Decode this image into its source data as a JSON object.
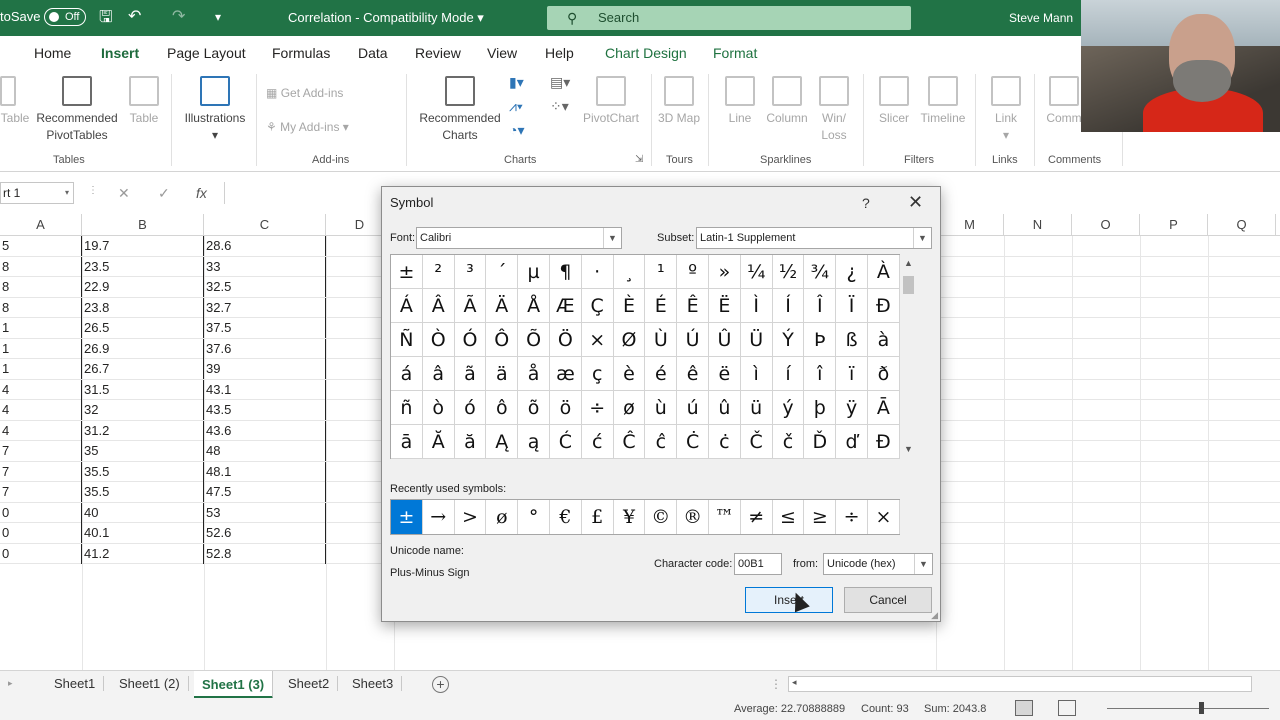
{
  "titlebar": {
    "autosave_label": "toSave",
    "autosave_state": "Off",
    "doc_title": "Correlation  -  Compatibility Mode",
    "search_placeholder": "Search",
    "user": "Steve Mann"
  },
  "ribbon_tabs": [
    "Home",
    "Insert",
    "Page Layout",
    "Formulas",
    "Data",
    "Review",
    "View",
    "Help",
    "Chart Design",
    "Format"
  ],
  "ribbon": {
    "tables": {
      "label": "Tables",
      "btn1": "Table",
      "btn2": "Recommended PivotTables",
      "btn3": "Table"
    },
    "illustrations": {
      "label": "Illustrations"
    },
    "addins": {
      "label": "Add-ins",
      "get": "Get Add-ins",
      "my": "My Add-ins"
    },
    "charts": {
      "label": "Charts",
      "recommended": "Recommended Charts",
      "pivotchart": "PivotChart"
    },
    "tours": {
      "label": "Tours",
      "map3d": "3D Map"
    },
    "sparklines": {
      "label": "Sparklines",
      "line": "Line",
      "column": "Column",
      "winloss": "Win/ Loss"
    },
    "filters": {
      "label": "Filters",
      "slicer": "Slicer",
      "timeline": "Timeline"
    },
    "links": {
      "label": "Links",
      "link": "Link"
    },
    "comments": {
      "label": "Comments",
      "comment": "Comm"
    }
  },
  "formula_bar": {
    "name_box": "rt 1",
    "cancel": "✕",
    "enter": "✓",
    "fx": "fx"
  },
  "columns": [
    "A",
    "B",
    "C",
    "D",
    "M",
    "N",
    "O",
    "P",
    "Q"
  ],
  "rows": [
    [
      "5",
      "19.7",
      "28.6"
    ],
    [
      "8",
      "23.5",
      "33"
    ],
    [
      "8",
      "22.9",
      "32.5"
    ],
    [
      "8",
      "23.8",
      "32.7"
    ],
    [
      "1",
      "26.5",
      "37.5"
    ],
    [
      "1",
      "26.9",
      "37.6"
    ],
    [
      "1",
      "26.7",
      "39"
    ],
    [
      "4",
      "31.5",
      "43.1"
    ],
    [
      "4",
      "32",
      "43.5"
    ],
    [
      "4",
      "31.2",
      "43.6"
    ],
    [
      "7",
      "35",
      "48"
    ],
    [
      "7",
      "35.5",
      "48.1"
    ],
    [
      "7",
      "35.5",
      "47.5"
    ],
    [
      "0",
      "40",
      "53"
    ],
    [
      "0",
      "40.1",
      "52.6"
    ],
    [
      "0",
      "41.2",
      "52.8"
    ]
  ],
  "sheet_tabs": [
    "Sheet1",
    "Sheet1 (2)",
    "Sheet1 (3)",
    "Sheet2",
    "Sheet3"
  ],
  "active_sheet": "Sheet1 (3)",
  "statusbar": {
    "average": "Average: 22.70888889",
    "count": "Count: 93",
    "sum": "Sum: 2043.8"
  },
  "dialog": {
    "title": "Symbol",
    "help": "?",
    "close": "✕",
    "font_label": "Font:",
    "font_value": "Calibri",
    "subset_label": "Subset:",
    "subset_value": "Latin-1 Supplement",
    "symbols": [
      "±",
      "²",
      "³",
      "´",
      "µ",
      "¶",
      "·",
      "¸",
      "¹",
      "º",
      "»",
      "¼",
      "½",
      "¾",
      "¿",
      "À",
      "Á",
      "Â",
      "Ã",
      "Ä",
      "Å",
      "Æ",
      "Ç",
      "È",
      "É",
      "Ê",
      "Ë",
      "Ì",
      "Í",
      "Î",
      "Ï",
      "Ð",
      "Ñ",
      "Ò",
      "Ó",
      "Ô",
      "Õ",
      "Ö",
      "×",
      "Ø",
      "Ù",
      "Ú",
      "Û",
      "Ü",
      "Ý",
      "Þ",
      "ß",
      "à",
      "á",
      "â",
      "ã",
      "ä",
      "å",
      "æ",
      "ç",
      "è",
      "é",
      "ê",
      "ë",
      "ì",
      "í",
      "î",
      "ï",
      "ð",
      "ñ",
      "ò",
      "ó",
      "ô",
      "õ",
      "ö",
      "÷",
      "ø",
      "ù",
      "ú",
      "û",
      "ü",
      "ý",
      "þ",
      "ÿ",
      "Ā",
      "ā",
      "Ă",
      "ă",
      "Ą",
      "ą",
      "Ć",
      "ć",
      "Ĉ",
      "ĉ",
      "Ċ",
      "ċ",
      "Č",
      "č",
      "Ď",
      "ď",
      "Đ"
    ],
    "recent_label": "Recently used symbols:",
    "recent": [
      "±",
      "→",
      ">",
      "ø",
      "°",
      "€",
      "£",
      "¥",
      "©",
      "®",
      "™",
      "≠",
      "≤",
      "≥",
      "÷",
      "×"
    ],
    "unicode_name_label": "Unicode name:",
    "unicode_name": "Plus-Minus Sign",
    "char_code_label": "Character code:",
    "char_code": "00B1",
    "from_label": "from:",
    "from_value": "Unicode (hex)",
    "insert": "Insert",
    "cancel": "Cancel"
  }
}
